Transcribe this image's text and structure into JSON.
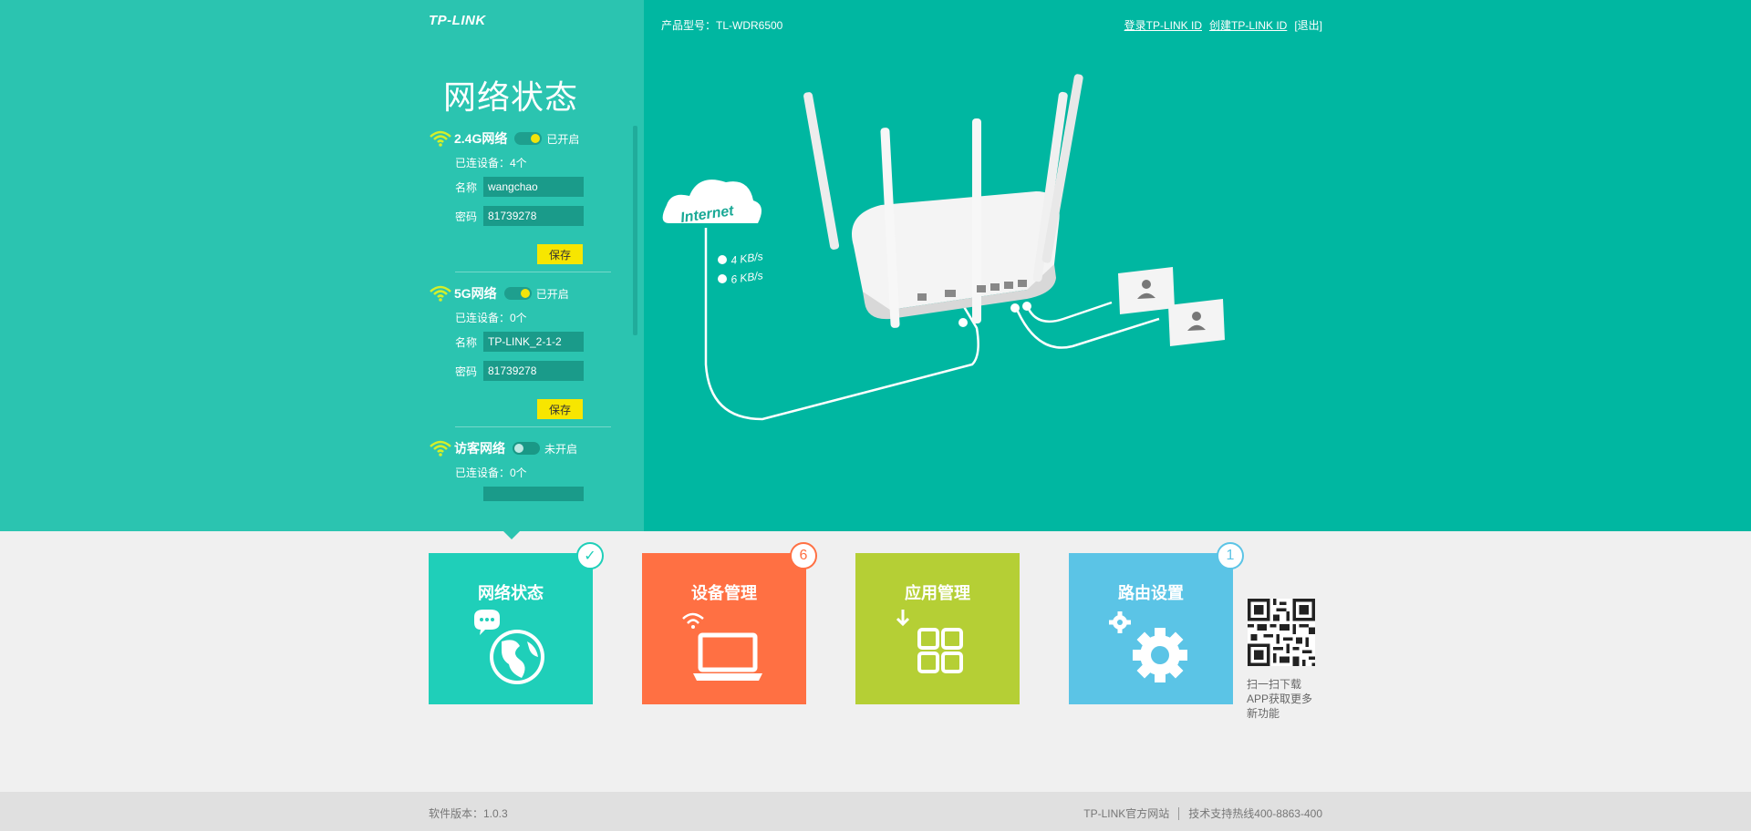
{
  "header": {
    "logo": "TP-LINK",
    "product_model": "产品型号：TL-WDR6500",
    "login_link": "登录TP-LINK ID",
    "create_link": "创建TP-LINK ID",
    "logout_link": "[退出]"
  },
  "status_title": "网络状态",
  "networks": [
    {
      "name": "2.4G网络",
      "enabled": true,
      "state_label": "已开启",
      "connected": "已连设备：4个",
      "ssid_label": "名称",
      "ssid": "wangchao",
      "password_label": "密码",
      "password": "81739278",
      "save_label": "保存"
    },
    {
      "name": "5G网络",
      "enabled": true,
      "state_label": "已开启",
      "connected": "已连设备：0个",
      "ssid_label": "名称",
      "ssid": "TP-LINK_2-1-2",
      "password_label": "密码",
      "password": "81739278",
      "save_label": "保存"
    },
    {
      "name": "访客网络",
      "enabled": false,
      "state_label": "未开启",
      "connected": "已连设备：0个"
    }
  ],
  "illustration": {
    "cloud_label": "Internet",
    "upload_speed": "4 KB/s",
    "download_speed": "6 KB/s"
  },
  "tiles": [
    {
      "title": "网络状态",
      "color": "#1fcfb9",
      "badge": "✓",
      "badge_color": "#1fcfb9",
      "icon": "globe-icon"
    },
    {
      "title": "设备管理",
      "color": "#ff7043",
      "badge": "6",
      "badge_color": "#ff7043",
      "icon": "laptop-icon"
    },
    {
      "title": "应用管理",
      "color": "#b5cf35",
      "badge": "",
      "icon": "apps-icon"
    },
    {
      "title": "路由设置",
      "color": "#5bc4e6",
      "badge": "1",
      "badge_color": "#5bc4e6",
      "icon": "gear-icon"
    }
  ],
  "qr": {
    "line1": "扫一扫下载",
    "line2": "APP获取更多",
    "line3": "新功能"
  },
  "footer": {
    "version": "软件版本：1.0.3",
    "website": "TP-LINK官方网站",
    "hotline": "技术支持热线400-8863-400"
  }
}
